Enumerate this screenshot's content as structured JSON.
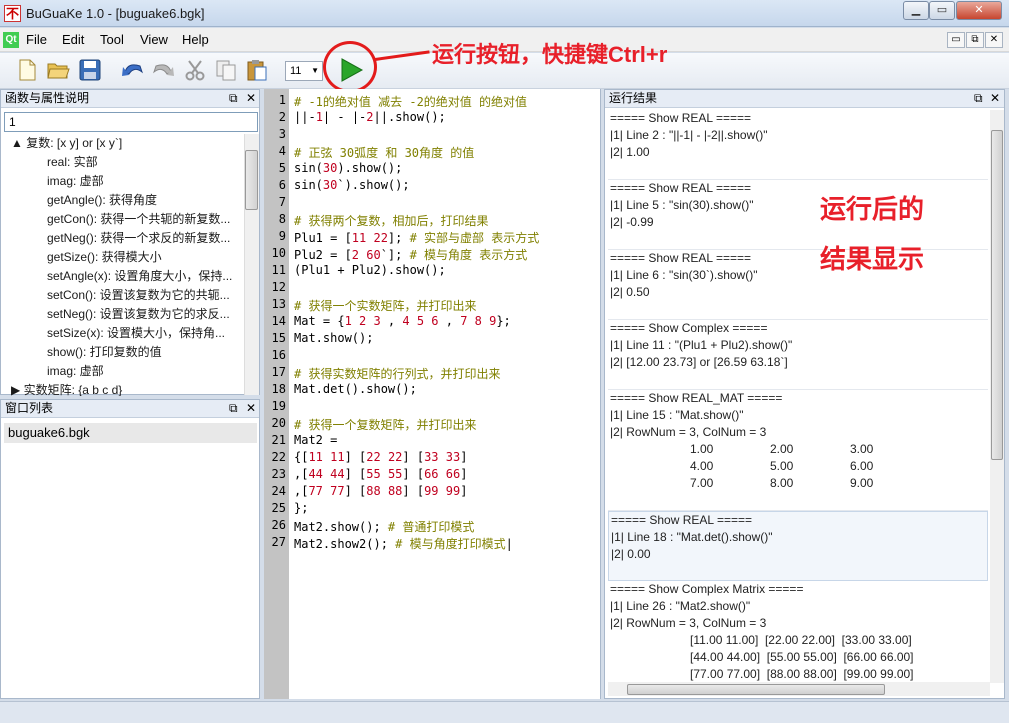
{
  "window": {
    "title": "BuGuaKe 1.0 - [buguake6.bgk]",
    "app_icon": "不",
    "min": "▁",
    "max": "▭",
    "close": "✕"
  },
  "menu": {
    "items": [
      "File",
      "Edit",
      "Tool",
      "View",
      "Help"
    ],
    "mdi": [
      "▭",
      "⧉",
      "✕"
    ]
  },
  "toolbar": {
    "icons": [
      "new-file-icon",
      "open-folder-icon",
      "save-icon",
      "undo-icon",
      "redo-icon",
      "cut-icon",
      "copy-icon",
      "paste-icon"
    ],
    "font_size": "11",
    "run_color": "#2aa52a"
  },
  "annotations": {
    "run_hint": "运行按钮，快捷键Ctrl+r",
    "result_hint_1": "运行后的",
    "result_hint_2": "结果显示",
    "color": "#e8202a"
  },
  "fn_panel": {
    "title": "函数与属性说明",
    "search": "1",
    "tree": [
      {
        "label": "▲ 复数: [x y] or [x y`]",
        "indent": 0
      },
      {
        "label": "real: 实部",
        "indent": 1
      },
      {
        "label": "imag: 虚部",
        "indent": 1
      },
      {
        "label": "getAngle(): 获得角度",
        "indent": 1
      },
      {
        "label": "getCon(): 获得一个共轭的新复数...",
        "indent": 1
      },
      {
        "label": "getNeg(): 获得一个求反的新复数...",
        "indent": 1
      },
      {
        "label": "getSize(): 获得模大小",
        "indent": 1
      },
      {
        "label": "setAngle(x): 设置角度大小，保持...",
        "indent": 1
      },
      {
        "label": "setCon(): 设置该复数为它的共轭...",
        "indent": 1
      },
      {
        "label": "setNeg(): 设置该复数为它的求反...",
        "indent": 1
      },
      {
        "label": "setSize(x): 设置模大小，保持角...",
        "indent": 1
      },
      {
        "label": "show(): 打印复数的值",
        "indent": 1
      },
      {
        "label": "imag: 虚部",
        "indent": 1
      },
      {
        "label": "▶ 实数矩阵: {a b c d}",
        "indent": 0
      }
    ]
  },
  "win_panel": {
    "title": "窗口列表",
    "items": [
      "buguake6.bgk"
    ]
  },
  "editor": {
    "lines": [
      {
        "n": "1",
        "h": "<span class='cm'># -1的绝对值 减去 -2的绝对值 的绝对值</span>"
      },
      {
        "n": "2",
        "h": "||-<span class='nm'>1</span>| - |-<span class='nm'>2</span>||.show();"
      },
      {
        "n": "3",
        "h": ""
      },
      {
        "n": "4",
        "h": "<span class='cm'># 正弦 30弧度 和 30角度 的值</span>"
      },
      {
        "n": "5",
        "h": "sin(<span class='nm'>30</span>).show();"
      },
      {
        "n": "6",
        "h": "sin(<span class='nm'>30</span>`).show();"
      },
      {
        "n": "7",
        "h": ""
      },
      {
        "n": "8",
        "h": "<span class='cm'># 获得两个复数，相加后，打印结果</span>"
      },
      {
        "n": "9",
        "h": "Plu1 = [<span class='nm'>11 22</span>]; <span class='cm'># 实部与虚部 表示方式</span>"
      },
      {
        "n": "10",
        "h": "Plu2 = [<span class='nm'>2 60</span>`]; <span class='cm'># 模与角度 表示方式</span>"
      },
      {
        "n": "11",
        "h": "(Plu1 + Plu2).show();"
      },
      {
        "n": "12",
        "h": ""
      },
      {
        "n": "13",
        "h": "<span class='cm'># 获得一个实数矩阵，并打印出来</span>"
      },
      {
        "n": "14",
        "h": "Mat = {<span class='nm'>1 2 3</span> , <span class='nm'>4 5 6</span> , <span class='nm'>7 8 9</span>};"
      },
      {
        "n": "15",
        "h": "Mat.show();"
      },
      {
        "n": "16",
        "h": ""
      },
      {
        "n": "17",
        "h": "<span class='cm'># 获得实数矩阵的行列式，并打印出来</span>"
      },
      {
        "n": "18",
        "h": "Mat.det().show();"
      },
      {
        "n": "19",
        "h": ""
      },
      {
        "n": "20",
        "h": "<span class='cm'># 获得一个复数矩阵，并打印出来</span>"
      },
      {
        "n": "21",
        "h": "Mat2 ="
      },
      {
        "n": "22",
        "h": "{[<span class='nm'>11 11</span>] [<span class='nm'>22 22</span>] [<span class='nm'>33 33</span>]"
      },
      {
        "n": "23",
        "h": ",[<span class='nm'>44 44</span>] [<span class='nm'>55 55</span>] [<span class='nm'>66 66</span>]"
      },
      {
        "n": "24",
        "h": ",[<span class='nm'>77 77</span>] [<span class='nm'>88 88</span>] [<span class='nm'>99 99</span>]"
      },
      {
        "n": "25",
        "h": "};"
      },
      {
        "n": "26",
        "h": "Mat2.show(); <span class='cm'># 普通打印模式</span>"
      },
      {
        "n": "27",
        "h": "Mat2.show2(); <span class='cm'># 模与角度打印模式</span>|"
      }
    ]
  },
  "result_panel": {
    "title": "运行结果",
    "blocks": [
      {
        "lines": [
          "===== Show REAL =====",
          "|1| Line 2 : \"||-1| - |-2||.show()\"",
          "|2| 1.00"
        ]
      },
      {
        "lines": [
          "===== Show REAL =====",
          "|1| Line 5 : \"sin(30).show()\"",
          "|2| -0.99"
        ]
      },
      {
        "lines": [
          "===== Show REAL =====",
          "|1| Line 6 : \"sin(30`).show()\"",
          "|2| 0.50"
        ]
      },
      {
        "lines": [
          "===== Show Complex =====",
          "|1| Line 11 : \"(Plu1 + Plu2).show()\"",
          "|2| [12.00 23.73] or [26.59 63.18`]"
        ]
      },
      {
        "lines": [
          "===== Show REAL_MAT =====",
          "|1| Line 15 : \"Mat.show()\"",
          "|2| RowNum = 3, ColNum = 3"
        ],
        "matrix": [
          [
            "1.00",
            "2.00",
            "3.00"
          ],
          [
            "4.00",
            "5.00",
            "6.00"
          ],
          [
            "7.00",
            "8.00",
            "9.00"
          ]
        ]
      },
      {
        "lines": [
          "===== Show REAL =====",
          "|1| Line 18 : \"Mat.det().show()\"",
          "|2| 0.00"
        ],
        "selected": true
      },
      {
        "lines": [
          "===== Show Complex Matrix =====",
          "|1| Line 26 : \"Mat2.show()\"",
          "|2| RowNum = 3, ColNum = 3"
        ],
        "cmatrix": [
          "[11.00 11.00]  [22.00 22.00]  [33.00 33.00]",
          "[44.00 44.00]  [55.00 55.00]  [66.00 66.00]",
          "[77.00 77.00]  [88.00 88.00]  [99.00 99.00]"
        ]
      }
    ]
  }
}
